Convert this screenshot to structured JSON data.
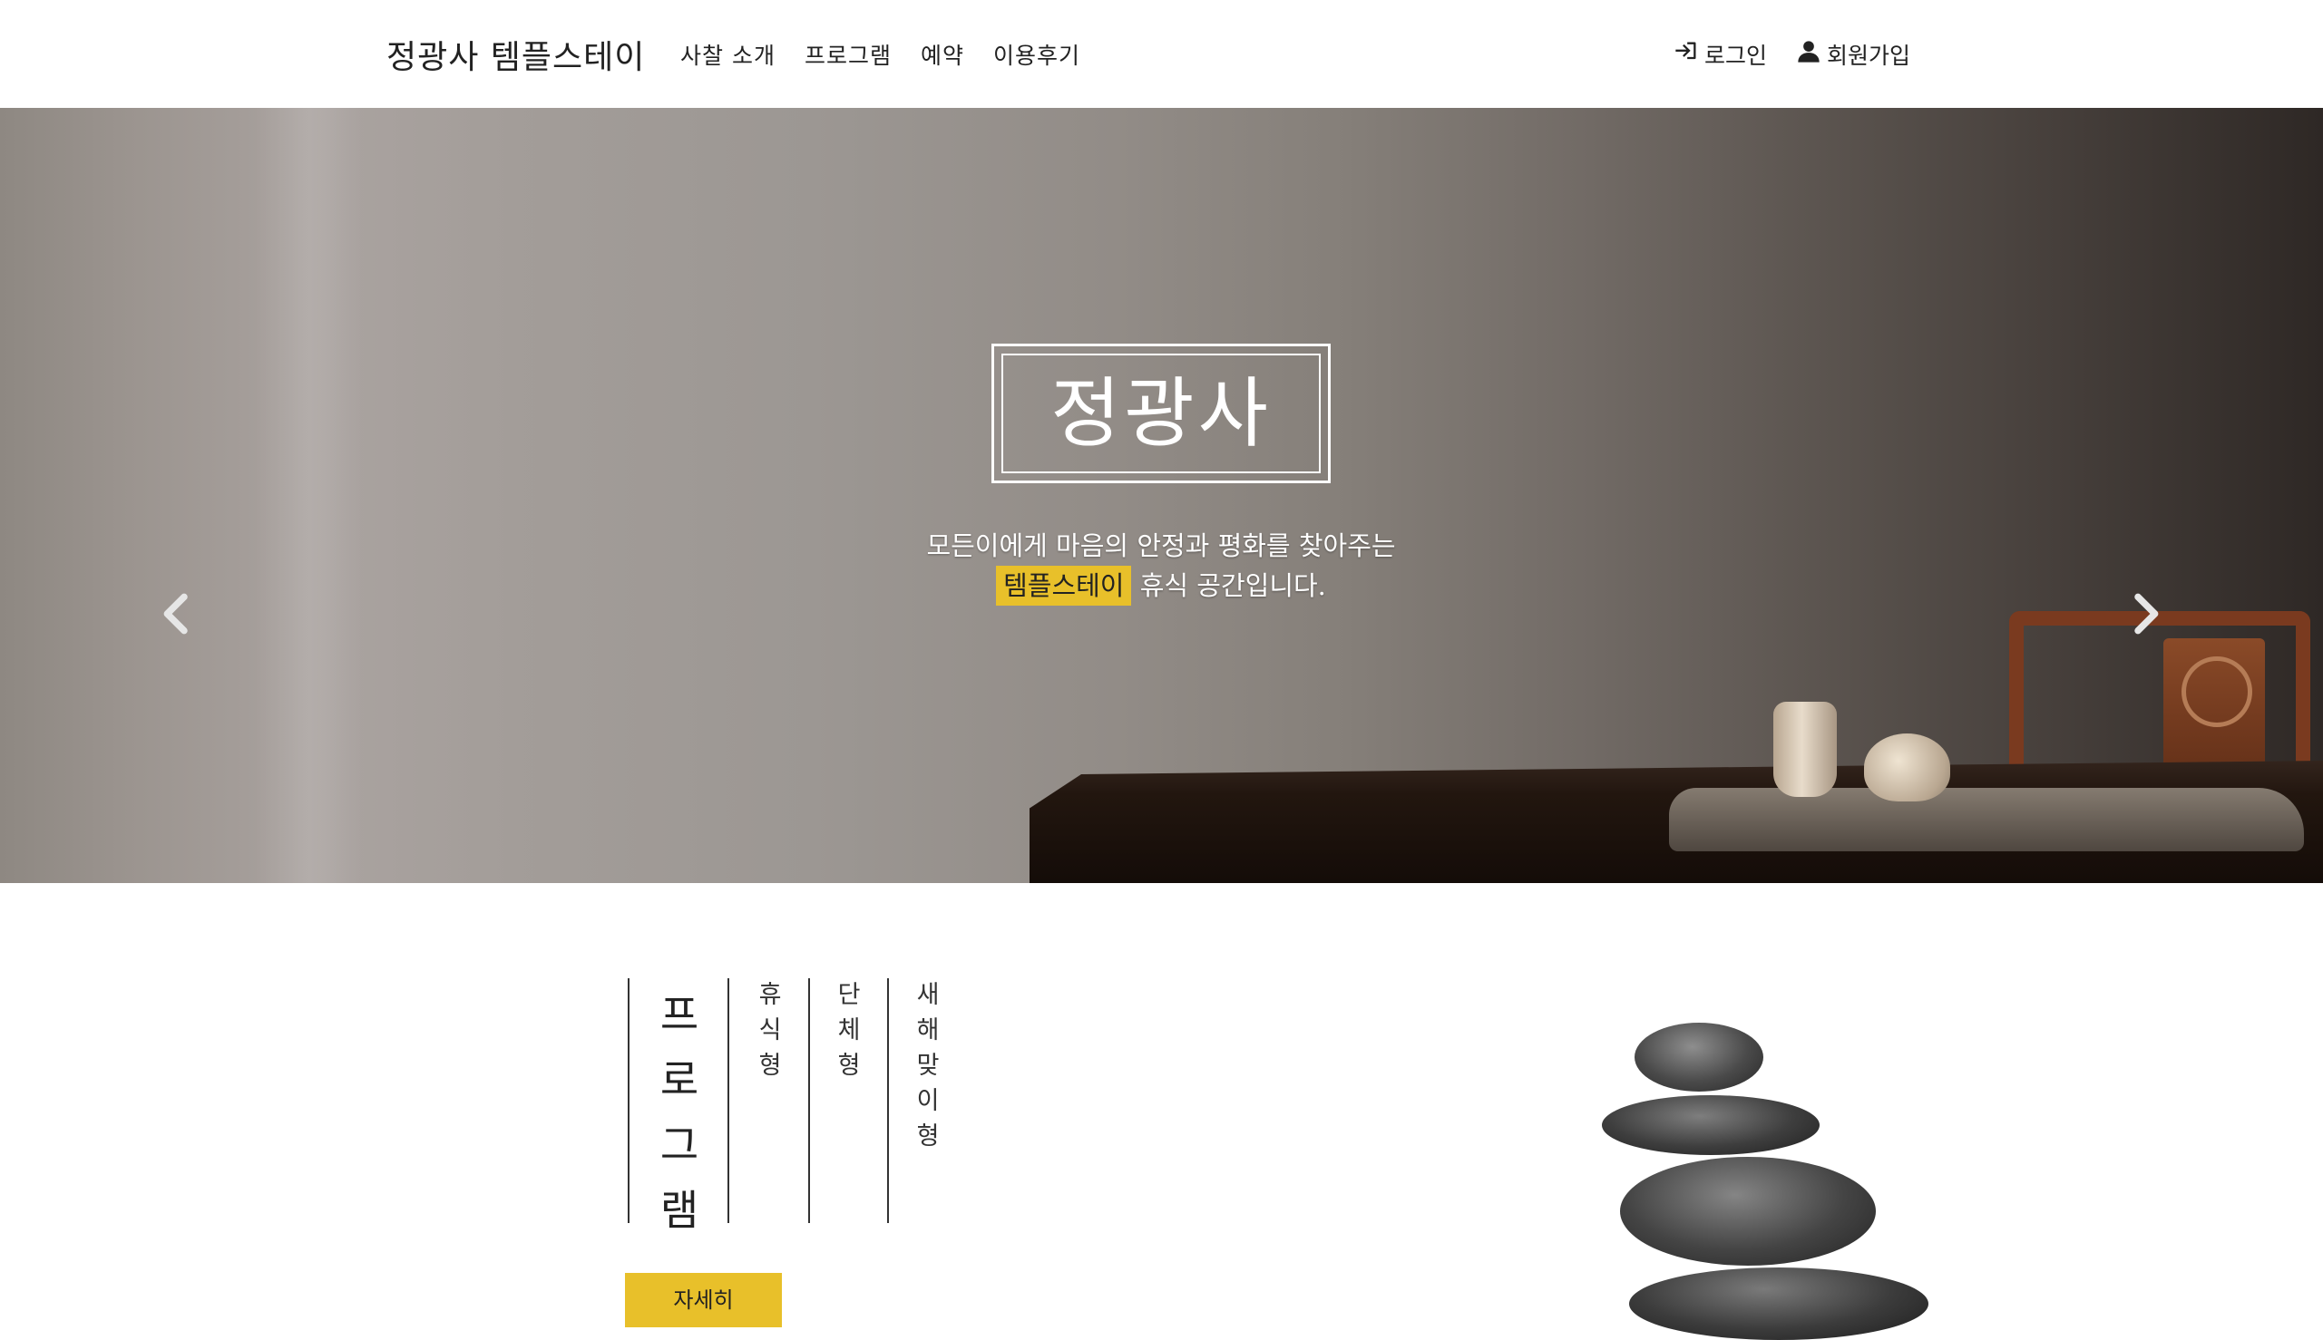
{
  "navbar": {
    "brand": "정광사 템플스테이",
    "links": [
      "사찰 소개",
      "프로그램",
      "예약",
      "이용후기"
    ],
    "login": "로그인",
    "signup": "회원가입"
  },
  "hero": {
    "title": "정광사",
    "subtitle_line1": "모든이에게 마음의 안정과 평화를 찾아주는",
    "subtitle_highlight": "템플스테이",
    "subtitle_line2_rest": " 휴식 공간입니다.",
    "slides_total": 2,
    "active_slide": 1
  },
  "program": {
    "title": "프로그램",
    "categories": [
      "휴식형",
      "단체형",
      "새해맞이형"
    ],
    "more_button": "자세히"
  },
  "colors": {
    "accent": "#e8c02a",
    "text": "#222222",
    "background": "#ffffff"
  },
  "icons": {
    "login": "sign-in-icon",
    "signup": "user-icon",
    "prev": "chevron-left-icon",
    "next": "chevron-right-icon"
  }
}
